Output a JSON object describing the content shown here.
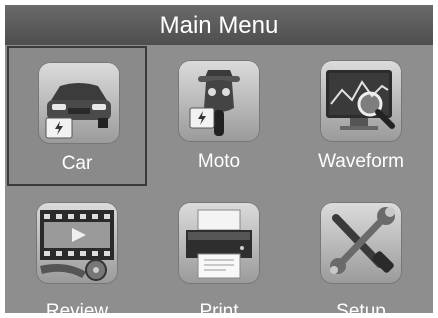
{
  "title": "Main Menu",
  "menu_items": [
    {
      "label": "Car",
      "icon": "car-icon",
      "selected": true
    },
    {
      "label": "Moto",
      "icon": "motorcycle-icon",
      "selected": false
    },
    {
      "label": "Waveform",
      "icon": "waveform-icon",
      "selected": false
    },
    {
      "label": "Review",
      "icon": "film-review-icon",
      "selected": false
    },
    {
      "label": "Print",
      "icon": "printer-icon",
      "selected": false
    },
    {
      "label": "Setup",
      "icon": "tools-icon",
      "selected": false
    }
  ],
  "colors": {
    "panel": "#8e8e8e",
    "title_bar": "#5a5a5a",
    "label": "#ffffff",
    "selection_border": "#3a3a3a"
  }
}
